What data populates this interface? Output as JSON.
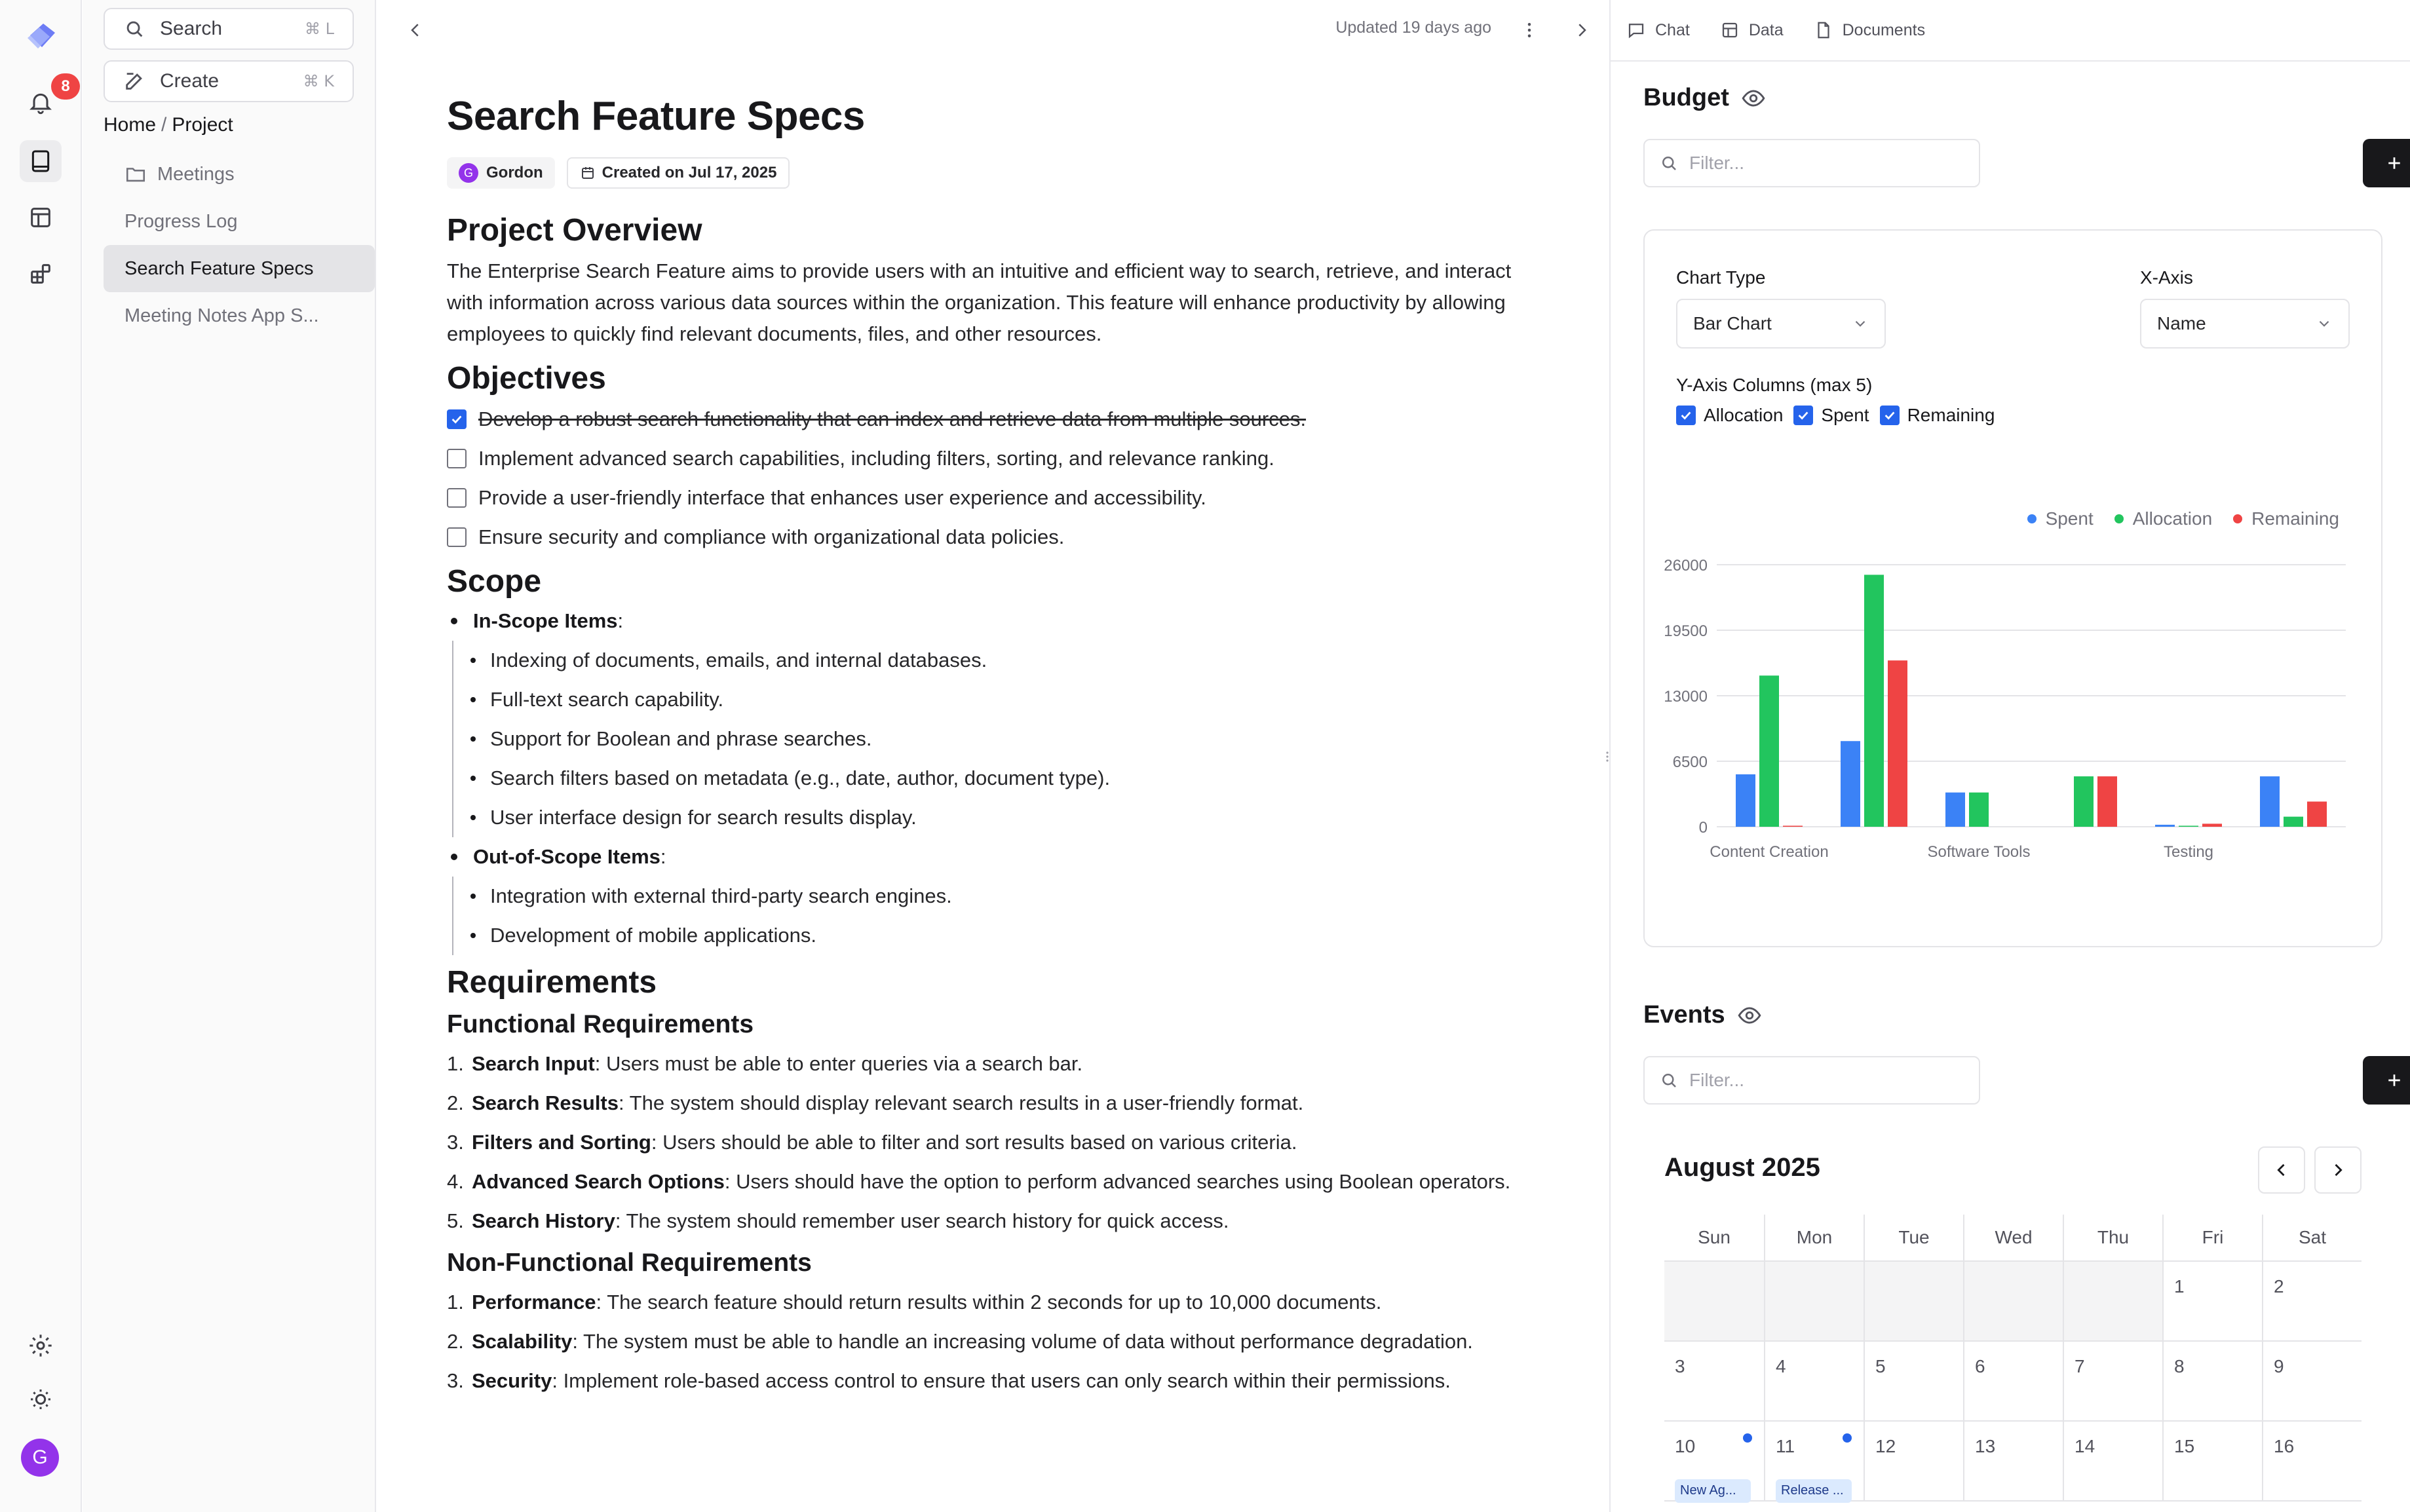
{
  "rail": {
    "notification_count": "8",
    "avatar_initial": "G"
  },
  "sidebar": {
    "search_label": "Search",
    "search_shortcut": "⌘ L",
    "create_label": "Create",
    "create_shortcut": "⌘ K",
    "breadcrumb": [
      "Home",
      "Project"
    ],
    "items": [
      {
        "label": "Meetings",
        "icon": "folder-icon"
      },
      {
        "label": "Progress Log"
      },
      {
        "label": "Search Feature Specs",
        "active": true
      },
      {
        "label": "Meeting Notes App S..."
      }
    ]
  },
  "doc": {
    "updated_text": "Updated 19 days ago",
    "title": "Search Feature Specs",
    "author_initial": "G",
    "author": "Gordon",
    "created": "Created on Jul 17, 2025",
    "overview_heading": "Project Overview",
    "overview_text": "The Enterprise Search Feature aims to provide users with an intuitive and efficient way to search, retrieve, and interact with information across various data sources within the organization. This feature will enhance productivity by allowing employees to quickly find relevant documents, files, and other resources.",
    "objectives_heading": "Objectives",
    "objectives": [
      {
        "text": "Develop a robust search functionality that can index and retrieve data from multiple sources.",
        "checked": true
      },
      {
        "text": "Implement advanced search capabilities, including filters, sorting, and relevance ranking.",
        "checked": false
      },
      {
        "text": "Provide a user-friendly interface that enhances user experience and accessibility.",
        "checked": false
      },
      {
        "text": "Ensure security and compliance with organizational data policies.",
        "checked": false
      }
    ],
    "scope_heading": "Scope",
    "in_scope_label": "In-Scope Items",
    "in_scope": [
      "Indexing of documents, emails, and internal databases.",
      "Full-text search capability.",
      "Support for Boolean and phrase searches.",
      "Search filters based on metadata (e.g., date, author, document type).",
      "User interface design for search results display."
    ],
    "out_scope_label": "Out-of-Scope Items",
    "out_scope": [
      "Integration with external third-party search engines.",
      "Development of mobile applications."
    ],
    "requirements_heading": "Requirements",
    "functional_heading": "Functional Requirements",
    "functional": [
      {
        "term": "Search Input",
        "text": ": Users must be able to enter queries via a search bar."
      },
      {
        "term": "Search Results",
        "text": ": The system should display relevant search results in a user-friendly format."
      },
      {
        "term": "Filters and Sorting",
        "text": ": Users should be able to filter and sort results based on various criteria."
      },
      {
        "term": "Advanced Search Options",
        "text": ": Users should have the option to perform advanced searches using Boolean operators."
      },
      {
        "term": "Search History",
        "text": ": The system should remember user search history for quick access."
      }
    ],
    "nonfunctional_heading": "Non-Functional Requirements",
    "nonfunctional": [
      {
        "term": "Performance",
        "text": ": The search feature should return results within 2 seconds for up to 10,000 documents."
      },
      {
        "term": "Scalability",
        "text": ": The system must be able to handle an increasing volume of data without performance degradation."
      },
      {
        "term": "Security",
        "text": ": Implement role-based access control to ensure that users can only search within their permissions."
      }
    ]
  },
  "right": {
    "tabs": [
      {
        "label": "Chat",
        "icon": "chat-icon"
      },
      {
        "label": "Data",
        "icon": "table-icon"
      },
      {
        "label": "Documents",
        "icon": "document-icon"
      }
    ],
    "budget": {
      "title": "Budget",
      "filter_placeholder": "Filter...",
      "chart_type_label": "Chart Type",
      "chart_type_value": "Bar Chart",
      "x_axis_label": "X-Axis",
      "x_axis_value": "Name",
      "y_columns_label": "Y-Axis Columns (max 5)",
      "y_columns": [
        {
          "label": "Allocation",
          "checked": true
        },
        {
          "label": "Spent",
          "checked": true
        },
        {
          "label": "Remaining",
          "checked": true
        }
      ]
    },
    "events": {
      "title": "Events",
      "filter_placeholder": "Filter...",
      "month": "August 2025",
      "weekdays": [
        "Sun",
        "Mon",
        "Tue",
        "Wed",
        "Thu",
        "Fri",
        "Sat"
      ],
      "weeks": [
        [
          "",
          "",
          "",
          "",
          "",
          "1",
          "2"
        ],
        [
          "3",
          "4",
          "5",
          "6",
          "7",
          "8",
          "9"
        ],
        [
          "10",
          "11",
          "12",
          "13",
          "14",
          "15",
          "16"
        ]
      ],
      "events": [
        {
          "day": "10",
          "label": "New Ag..."
        },
        {
          "day": "11",
          "label": "Release ..."
        }
      ]
    }
  },
  "colors": {
    "spent": "#3b82f6",
    "allocation": "#22c55e",
    "remaining": "#ef4444",
    "accent": "#2563eb"
  },
  "chart_data": {
    "type": "bar",
    "categories": [
      "Content Creation",
      "",
      "Software Tools",
      "",
      "Testing",
      ""
    ],
    "category_labels_shown": [
      "Content Creation",
      "Software Tools",
      "Testing"
    ],
    "series": [
      {
        "name": "Spent",
        "values": [
          5200,
          8500,
          3400,
          0,
          200,
          5000
        ]
      },
      {
        "name": "Allocation",
        "values": [
          15000,
          25000,
          3400,
          5000,
          100,
          1000
        ]
      },
      {
        "name": "Remaining",
        "values": [
          100,
          16500,
          0,
          5000,
          300,
          2500
        ]
      }
    ],
    "yticks": [
      "0",
      "6500",
      "13000",
      "19500",
      "26000"
    ],
    "ylim": [
      0,
      26000
    ],
    "legend_position": "top-right",
    "grid": true
  }
}
